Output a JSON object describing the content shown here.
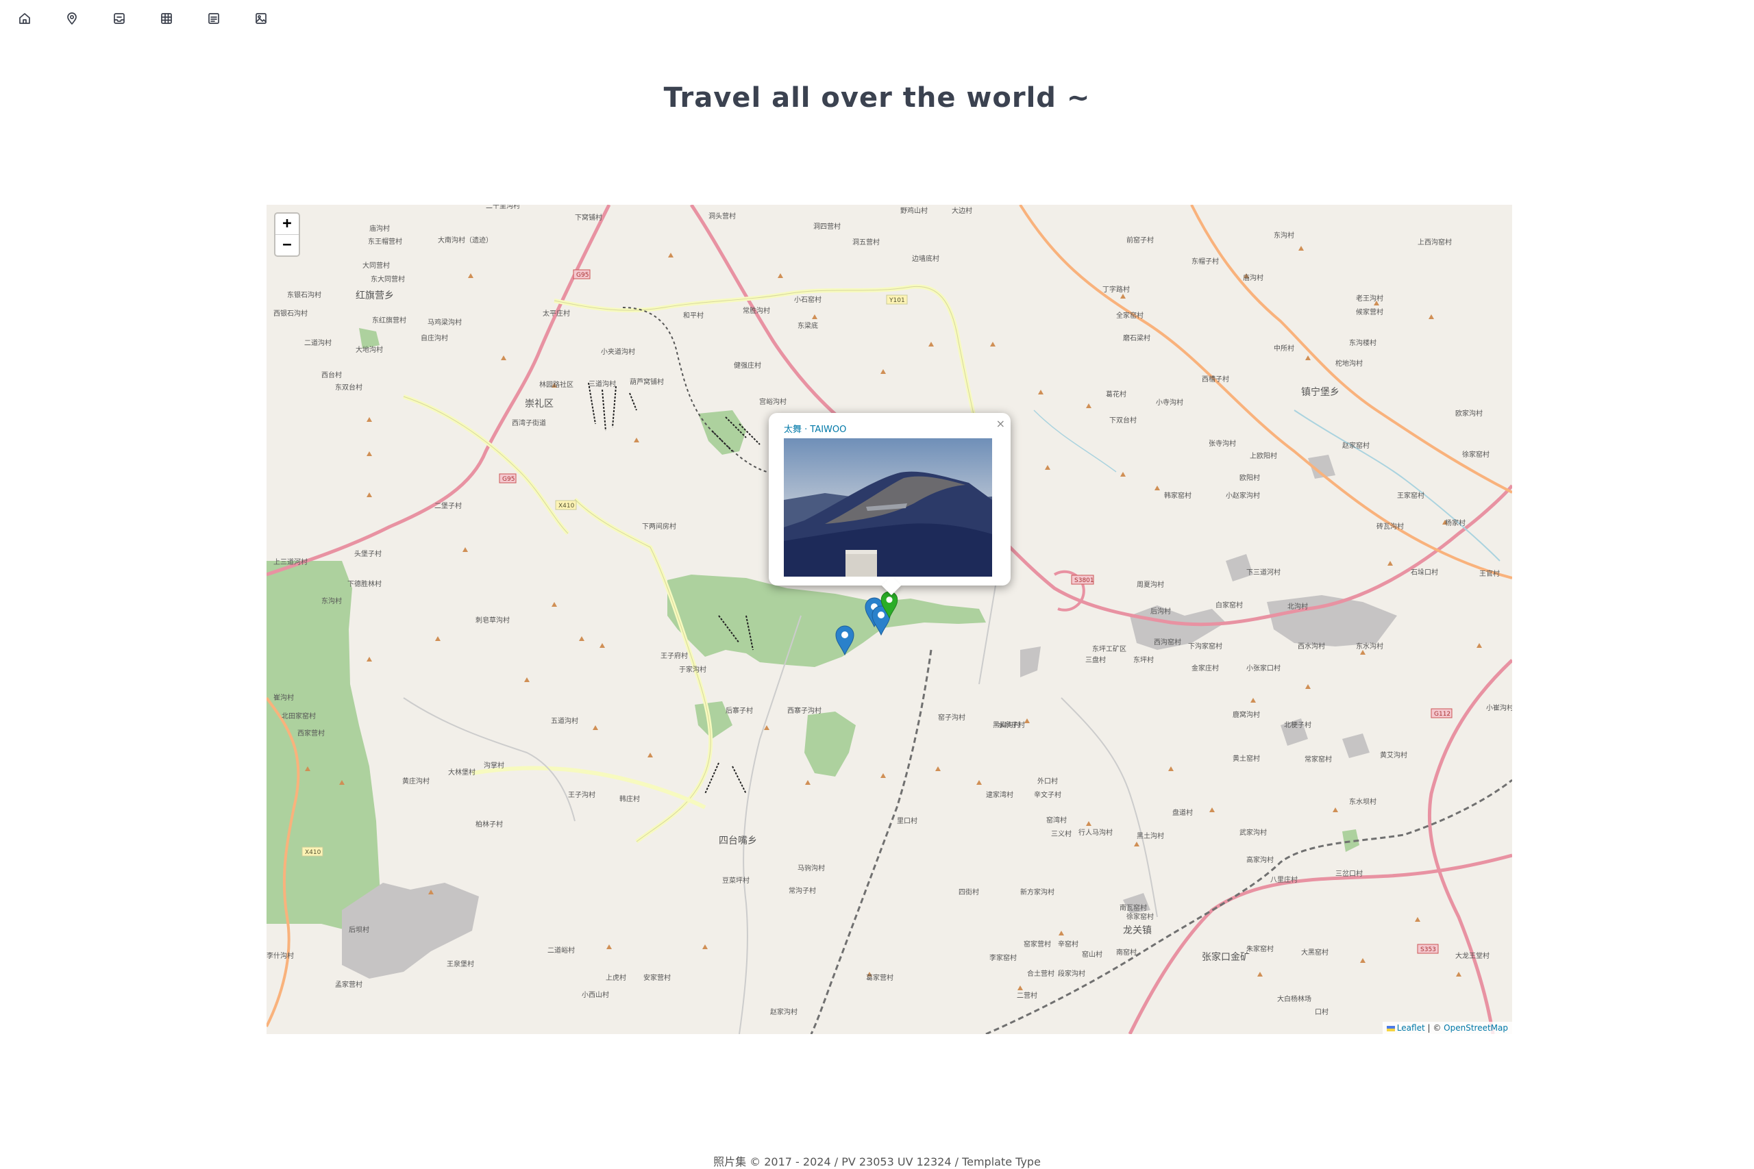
{
  "nav": {
    "icons": [
      "home-icon",
      "location-pin-icon",
      "inbox-icon",
      "grid-icon",
      "list-icon",
      "image-icon"
    ]
  },
  "title": "Travel all over the world ~",
  "map": {
    "zoom_in": "+",
    "zoom_out": "−",
    "attribution": {
      "leaflet": "Leaflet",
      "separator": " | © ",
      "osm": "OpenStreetMap"
    },
    "popup": {
      "link_text": "太舞 · TAIWOO",
      "close": "×"
    },
    "labels": [
      "二十里沟村",
      "下窝铺村",
      "洞头营村",
      "野鸡山村",
      "大边村",
      "庙沟村",
      "大南沟村（遗迹）",
      "东王帽营村",
      "洞四营村",
      "洞五营村",
      "边墙底村",
      "前窑子村",
      "东沟村",
      "上西沟窑村",
      "东帽子村",
      "庙沟村",
      "大同营村",
      "东大同营村",
      "红旗营乡",
      "东银石沟村",
      "丁字路村",
      "西银石沟村",
      "东红旗营村",
      "马鸡梁沟村",
      "太平庄村",
      "和平村",
      "常胜沟村",
      "小石窑村",
      "东梁底",
      "老王沟村",
      "候家营村",
      "全家窑村",
      "二道沟村",
      "自庄沟村",
      "大地沟村",
      "小夹道沟村",
      "磨石梁村",
      "中所村",
      "东沟楼村",
      "柁地沟村",
      "三道沟村",
      "葫芦窝铺村",
      "西台村",
      "东双台村",
      "林园路社区",
      "葛花村",
      "西槽子村",
      "镇宁堡乡",
      "崇礼区",
      "小寺沟村",
      "西湾子街道",
      "下双台村",
      "张寺沟村",
      "赵家窑村",
      "欧家沟村",
      "上欧阳村",
      "徐家窑村",
      "欧阳村",
      "韩家窑村",
      "小赵家沟村",
      "王家窑村",
      "二堡子村",
      "下两间房村",
      "砖瓦沟村",
      "杨家村",
      "头堡子村",
      "上三道河村",
      "下德胜林村",
      "下三道河村",
      "石垛口村",
      "王官村",
      "周夏沟村",
      "白家窑村",
      "后沟村",
      "北沟村",
      "东沟村",
      "刺皂草沟村",
      "王子府村",
      "东坪工矿区",
      "三盘村",
      "西沟窑村",
      "下沟家窑村",
      "西水沟村",
      "东水沟村",
      "于家沟村",
      "东坪村",
      "金家庄村",
      "小张家口村",
      "后寨子村",
      "西寨子沟村",
      "窑子沟村",
      "水泉子村",
      "鹿窝沟村",
      "北梗子村",
      "小崔沟村",
      "崔沟村",
      "北田家窑村",
      "西家营村",
      "五道沟村",
      "黑扁沟村",
      "沟掌村",
      "黄土窑村",
      "常家窑村",
      "黄艾沟村",
      "黄庄沟村",
      "大林堡村",
      "王子沟村",
      "逮家湾村",
      "辛文子村",
      "外口村",
      "里口村",
      "窑湾村",
      "三义村",
      "盘道村",
      "武家沟村",
      "东水坝村",
      "韩庄村",
      "柏林子村",
      "行人马沟村",
      "黑土沟村",
      "四台嘴乡",
      "高家沟村",
      "马驹沟村",
      "三岔口村",
      "八里庄村",
      "豆菜坪村",
      "常沟子村",
      "新方家沟村",
      "徐家窑村",
      "南瓦窑村",
      "龙关镇",
      "四街村",
      "窑家营村",
      "辛窑村",
      "南窑村",
      "朱家窑村",
      "二道峪村",
      "后坝村",
      "窑山村",
      "张家口金矿",
      "大黑窑村",
      "大龙王堂村",
      "李家窑村",
      "合土营村",
      "段家沟村",
      "上虎村",
      "王泉堡村",
      "孟家营村",
      "安家营村",
      "葛家营村",
      "二营村",
      "大白杨林场",
      "小西山村",
      "李什沟村",
      "赵家沟村",
      "口村",
      "健强庄村",
      "宫峪沟村"
    ]
  },
  "footer": {
    "text": "照片集 © 2017 - 2024 / PV 23053 UV 12324 / Template Type"
  }
}
